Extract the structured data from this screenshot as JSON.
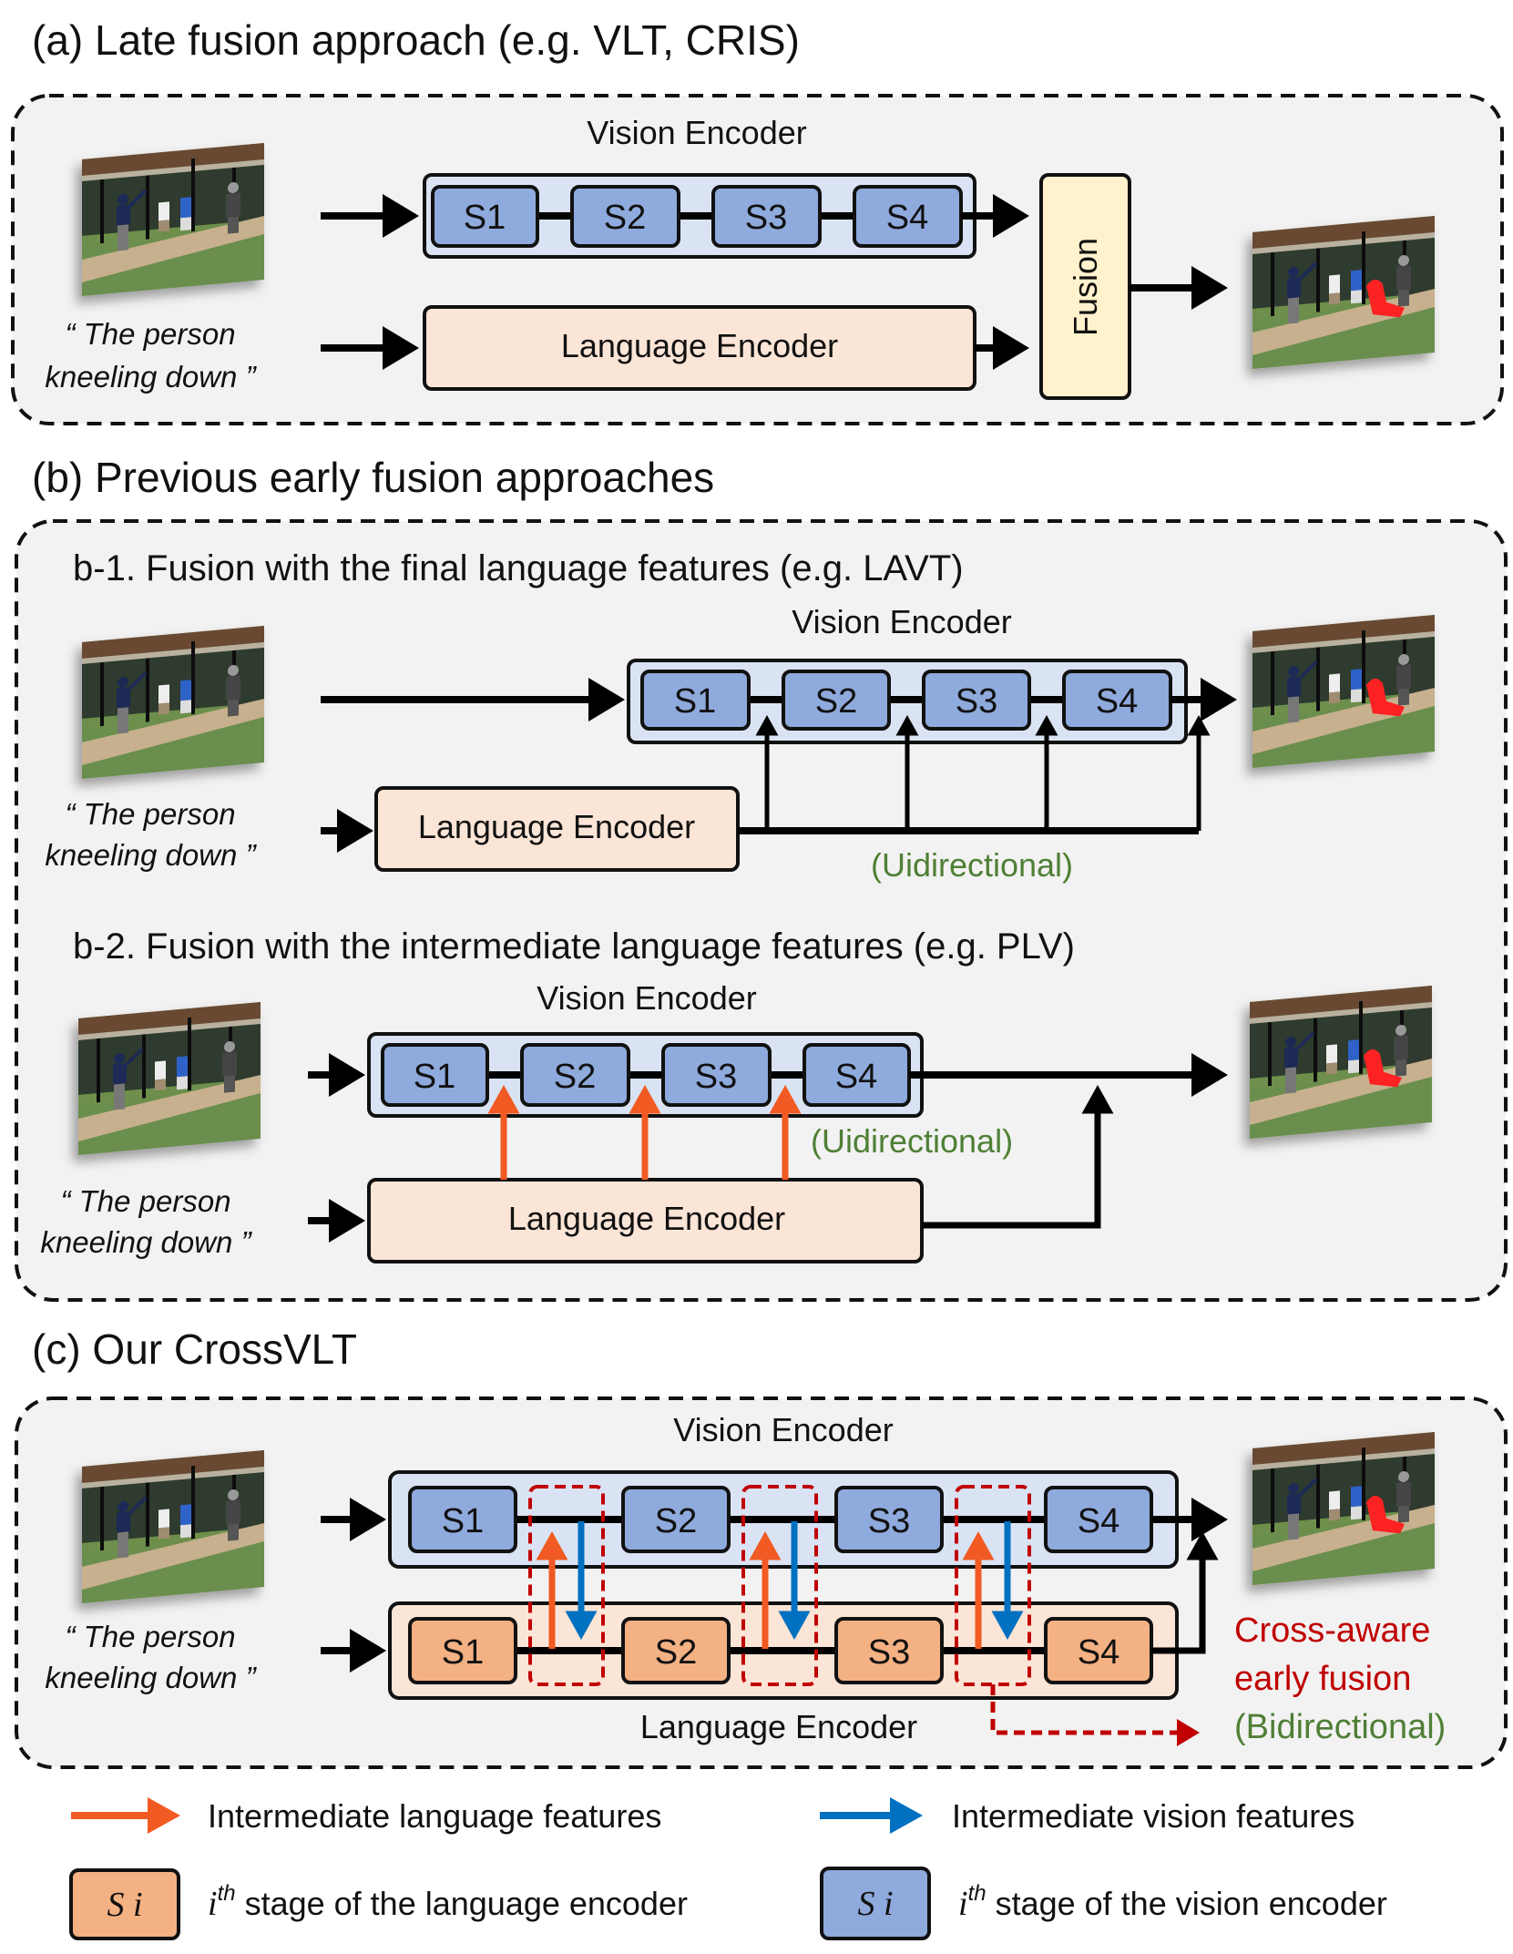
{
  "panel_a": {
    "title": "(a) Late fusion approach (e.g. VLT, CRIS)",
    "vision_encoder_label": "Vision Encoder",
    "language_encoder_label": "Language Encoder",
    "fusion_label": "Fusion",
    "stages": [
      "S1",
      "S2",
      "S3",
      "S4"
    ],
    "query_line1": "“ The person",
    "query_line2": "kneeling down ”"
  },
  "panel_b": {
    "title": "(b) Previous early fusion approaches",
    "b1": {
      "title": "b-1. Fusion with the final language features (e.g. LAVT)",
      "vision_encoder_label": "Vision Encoder",
      "language_encoder_label": "Language Encoder",
      "stages": [
        "S1",
        "S2",
        "S3",
        "S4"
      ],
      "direction_label": "(Uidirectional)",
      "query_line1": "“ The person",
      "query_line2": "kneeling down ”"
    },
    "b2": {
      "title": "b-2. Fusion with the intermediate language features (e.g. PLV)",
      "vision_encoder_label": "Vision Encoder",
      "language_encoder_label": "Language Encoder",
      "stages": [
        "S1",
        "S2",
        "S3",
        "S4"
      ],
      "direction_label": "(Uidirectional)",
      "query_line1": "“ The person",
      "query_line2": "kneeling down ”"
    }
  },
  "panel_c": {
    "title": "(c) Our CrossVLT",
    "vision_encoder_label": "Vision Encoder",
    "language_encoder_label": "Language Encoder",
    "vision_stages": [
      "S1",
      "S2",
      "S3",
      "S4"
    ],
    "language_stages": [
      "S1",
      "S2",
      "S3",
      "S4"
    ],
    "annotation_line1": "Cross-aware",
    "annotation_line2": "early fusion",
    "annotation_line3": "(Bidirectional)",
    "query_line1": "“ The person",
    "query_line2": "kneeling down ”"
  },
  "legend": {
    "orange_arrow": "Intermediate language features",
    "blue_arrow": "Intermediate vision features",
    "stage_symbol": "S i",
    "language_stage_sup": "th",
    "language_stage_i": "i",
    "language_stage_text": " stage of the language encoder",
    "vision_stage_sup": "th",
    "vision_stage_i": "i",
    "vision_stage_text": " stage of the vision encoder"
  },
  "colors": {
    "vision_stage": "#8faadc",
    "vision_encoder": "#dae3f3",
    "language_stage": "#f4b183",
    "language_encoder": "#fbe5d6",
    "fusion": "#fff2cc",
    "language_feature_arrow": "#f15a22",
    "vision_feature_arrow": "#0070c0",
    "highlight": "#c00000",
    "direction_text": "#4f7f35"
  }
}
